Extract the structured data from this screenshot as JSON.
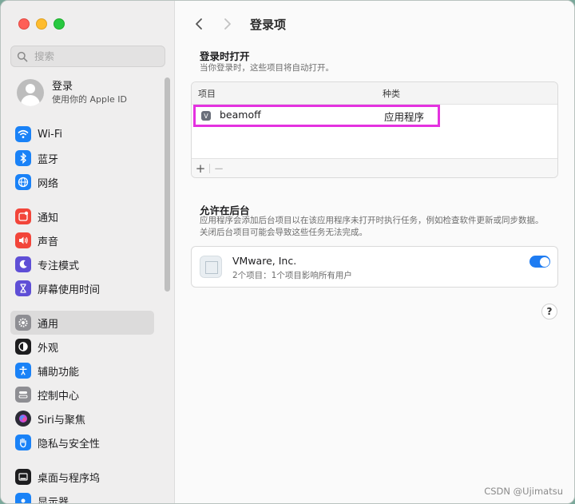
{
  "sidebar": {
    "search_placeholder": "搜索",
    "account": {
      "name": "登录",
      "subtitle": "使用你的 Apple ID"
    },
    "group1": [
      {
        "label": "Wi-Fi",
        "icon": "wifi-icon",
        "color": "#1a82f7"
      },
      {
        "label": "蓝牙",
        "icon": "bluetooth-icon",
        "color": "#1a82f7"
      },
      {
        "label": "网络",
        "icon": "globe-icon",
        "color": "#1a82f7"
      }
    ],
    "group2": [
      {
        "label": "通知",
        "icon": "notification-icon",
        "color": "#f2453a"
      },
      {
        "label": "声音",
        "icon": "sound-icon",
        "color": "#f2453a"
      },
      {
        "label": "专注模式",
        "icon": "moon-icon",
        "color": "#5f4fd6"
      },
      {
        "label": "屏幕使用时间",
        "icon": "hourglass-icon",
        "color": "#5f4fd6"
      }
    ],
    "group3": [
      {
        "label": "通用",
        "icon": "gear-icon",
        "color": "#8e8e93",
        "selected": true
      },
      {
        "label": "外观",
        "icon": "appearance-icon",
        "color": "#1d1d1f"
      },
      {
        "label": "辅助功能",
        "icon": "accessibility-icon",
        "color": "#1a82f7"
      },
      {
        "label": "控制中心",
        "icon": "control-center-icon",
        "color": "#8e8e93"
      },
      {
        "label": "Siri与聚焦",
        "icon": "siri-icon",
        "color": "#2b2b36"
      },
      {
        "label": "隐私与安全性",
        "icon": "hand-icon",
        "color": "#1a82f7"
      }
    ],
    "group4": [
      {
        "label": "桌面与程序坞",
        "icon": "dock-icon",
        "color": "#1d1d1f"
      },
      {
        "label": "显示器",
        "icon": "display-icon",
        "color": "#1a82f7"
      }
    ]
  },
  "header": {
    "title": "登录项"
  },
  "login_section": {
    "title": "登录时打开",
    "description": "当你登录时，这些项目将自动打开。",
    "columns": {
      "item": "项目",
      "kind": "种类"
    },
    "rows": [
      {
        "name": "beamoff",
        "kind": "应用程序"
      }
    ],
    "add_label": "+",
    "remove_label": "−"
  },
  "background_section": {
    "title": "允许在后台",
    "description": "应用程序会添加后台项目以在该应用程序未打开时执行任务，例如检查软件更新或同步数据。关闭后台项目可能会导致这些任务无法完成。",
    "items": [
      {
        "name": "VMware, Inc.",
        "subtitle": "2个项目：1个项目影响所有用户",
        "enabled": true
      }
    ]
  },
  "help_label": "?",
  "watermark": "CSDN @Ujimatsu"
}
